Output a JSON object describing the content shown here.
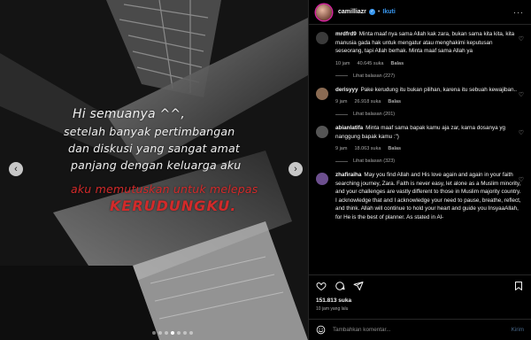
{
  "media": {
    "caption": {
      "line1": "Hi semuanya ^^,",
      "line2": "setelah banyak pertimbangan",
      "line3": "dan diskusi yang sangat amat",
      "line4": "panjang dengan keluarga aku",
      "line5": "aku memutuskan untuk melepas",
      "line6": "KERUDUNGKU."
    },
    "prev_glyph": "‹",
    "next_glyph": "›",
    "dots_count": 7,
    "active_dot": 3
  },
  "header": {
    "username": "camilliazr",
    "verified_glyph": "✓",
    "separator": "•",
    "follow_label": "Ikuti",
    "more_glyph": "···"
  },
  "comments": [
    {
      "user": "mrdfrd9",
      "text": "Minta maaf nya sama Allah kak zara, bukan sama kita kita, kita manusia gada hak untuk mengatur atau menghakimi keputusan seseorang, tapi Allah berhak. Minta maaf sama Allah ya",
      "time": "10 jam",
      "likes": "40.645 suka",
      "reply_label": "Balas",
      "replies": "Lihat balasan (227)",
      "avatar_color": "#3a3a3a"
    },
    {
      "user": "derisyyy",
      "text": "Pake kerudung itu bukan pilihan, karena itu sebuah kewajiban..",
      "time": "9 jam",
      "likes": "26.918 suka",
      "reply_label": "Balas",
      "replies": "Lihat balasan (201)",
      "avatar_color": "#8a6a52"
    },
    {
      "user": "abianlatifa",
      "text": "Minta maaf sama bapak kamu aja zar, karna dosanya yg nanggung bapak kamu :\")",
      "time": "9 jam",
      "likes": "18.063 suka",
      "reply_label": "Balas",
      "replies": "Lihat balasan (323)",
      "avatar_color": "#555555"
    },
    {
      "user": "zhafiraiha",
      "text": "May you find Allah and His love again and again in your faith searching journey, Zara. Faith is never easy, let alone as a Muslim minority, and your challenges are vastly different to those in Muslim majority country. I acknowledge that and I acknowledge your need to pause, breathe, reflect, and think. Allah will continue to hold your heart and guide you InsyaaAllah, for He is the best of planner. As stated in Al-",
      "time": "",
      "likes": "",
      "reply_label": "",
      "replies": "",
      "avatar_color": "#6c4f8e"
    }
  ],
  "like_glyph": "♡",
  "post_stats": {
    "likes": "151.813 suka",
    "time": "10 jam yang lalu"
  },
  "comment_box": {
    "placeholder": "Tambahkan komentar...",
    "post_label": "Kirim"
  }
}
